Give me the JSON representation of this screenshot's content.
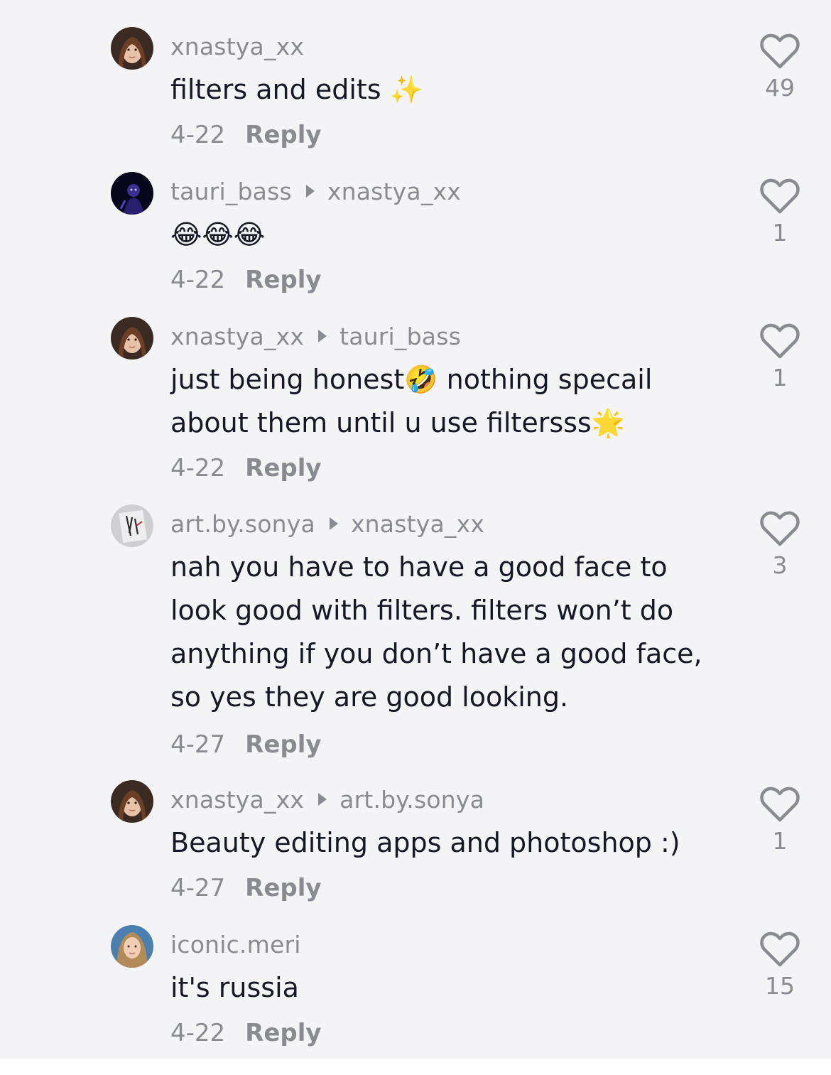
{
  "comments": [
    {
      "username": "xnastya_xx",
      "reply_to": "",
      "text": "filters and edits ✨",
      "date": "4-22",
      "reply_label": "Reply",
      "likes": "49"
    },
    {
      "username": "tauri_bass",
      "reply_to": "xnastya_xx",
      "text": "😂😂😂",
      "date": "4-22",
      "reply_label": "Reply",
      "likes": "1"
    },
    {
      "username": "xnastya_xx",
      "reply_to": "tauri_bass",
      "text": "just being honest🤣 nothing specail about them until u use filtersss🌟",
      "date": "4-22",
      "reply_label": "Reply",
      "likes": "1"
    },
    {
      "username": "art.by.sonya",
      "reply_to": "xnastya_xx",
      "text": "nah you have to have a good face to look good with filters. filters won’t do anything if you don’t have a good face, so yes they are good looking.",
      "date": "4-27",
      "reply_label": "Reply",
      "likes": "3"
    },
    {
      "username": "xnastya_xx",
      "reply_to": "art.by.sonya",
      "text": "Beauty editing apps and photoshop :)",
      "date": "4-27",
      "reply_label": "Reply",
      "likes": "1"
    },
    {
      "username": "iconic.meri",
      "reply_to": "",
      "text": "it's russia",
      "date": "4-22",
      "reply_label": "Reply",
      "likes": "15"
    }
  ]
}
